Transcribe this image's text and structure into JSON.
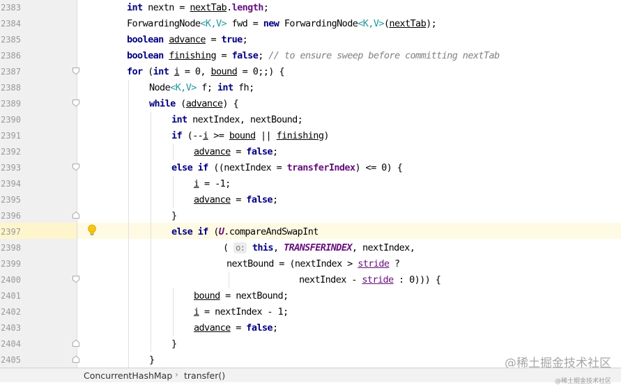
{
  "editor": {
    "line_numbers": [
      "2383",
      "2384",
      "2385",
      "2386",
      "2387",
      "2388",
      "2389",
      "2390",
      "2391",
      "2392",
      "2393",
      "2394",
      "2395",
      "2396",
      "2397",
      "2398",
      "2399",
      "2400",
      "2401",
      "2402",
      "2403",
      "2404",
      "2405"
    ],
    "current_line": "2397"
  },
  "breadcrumb": {
    "class_name": "ConcurrentHashMap",
    "method_name": "transfer()"
  },
  "watermark": {
    "text": "@稀土掘金技术社区",
    "subtext": "@稀土掘金技术社区"
  },
  "tokens": {
    "l2383": [
      "int",
      "nextn = ",
      "nextTab",
      ".",
      "length",
      ";"
    ],
    "l2384": [
      "ForwardingNode",
      "<K,V>",
      " fwd = ",
      "new",
      " ForwardingNode",
      "<K,V>",
      "(",
      "nextTab",
      ");"
    ],
    "l2385": [
      "boolean",
      " ",
      "advance",
      " = ",
      "true",
      ";"
    ],
    "l2386": [
      "boolean",
      " ",
      "finishing",
      " = ",
      "false",
      "; ",
      "// to ensure sweep before committing nextTab"
    ],
    "l2387": [
      "for",
      " (",
      "int",
      " ",
      "i",
      " = 0, ",
      "bound",
      " = 0;;) {"
    ],
    "l2388": [
      "Node",
      "<K,V>",
      " f; ",
      "int",
      " fh;"
    ],
    "l2389": [
      "while",
      " (",
      "advance",
      ") {"
    ],
    "l2390": [
      "int",
      " nextIndex, nextBound;"
    ],
    "l2391": [
      "if",
      " (--",
      "i",
      " >= ",
      "bound",
      " || ",
      "finishing",
      ")"
    ],
    "l2392": [
      "advance",
      " = ",
      "false",
      ";"
    ],
    "l2393": [
      "else if",
      " ((nextIndex = ",
      "transferIndex",
      ") <= 0) {"
    ],
    "l2394": [
      "i",
      " = -1;"
    ],
    "l2395": [
      "advance",
      " = ",
      "false",
      ";"
    ],
    "l2396": [
      "}"
    ],
    "l2397": [
      "else if",
      " (",
      "U",
      ".compareAndSwapInt"
    ],
    "l2398": [
      "( ",
      "o:",
      " ",
      "this",
      ", ",
      "TRANSFERINDEX",
      ", nextIndex,"
    ],
    "l2399": [
      "nextBound = (nextIndex > ",
      "stride",
      " ?"
    ],
    "l2400": [
      "nextIndex - ",
      "stride",
      " : 0))) {"
    ],
    "l2401": [
      "bound",
      " = nextBound;"
    ],
    "l2402": [
      "i",
      " = nextIndex - 1;"
    ],
    "l2403": [
      "advance",
      " = ",
      "false",
      ";"
    ],
    "l2404": [
      "}"
    ],
    "l2405": [
      "}"
    ]
  }
}
